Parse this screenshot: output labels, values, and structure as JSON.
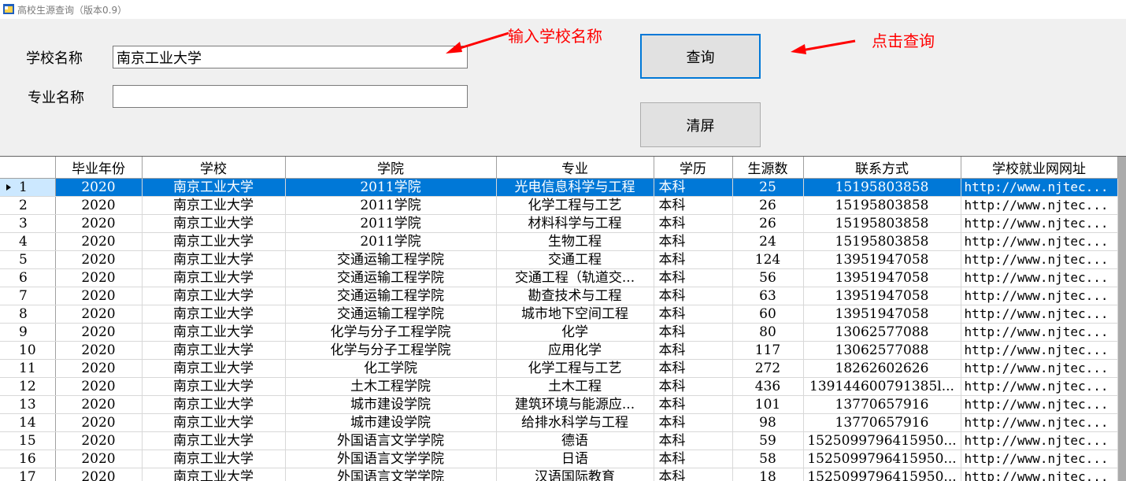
{
  "window": {
    "title": "高校生源查询（版本0.9）",
    "icon": "app-window-icon"
  },
  "form": {
    "school_label": "学校名称",
    "school_value": "南京工业大学",
    "major_label": "专业名称",
    "major_value": ""
  },
  "buttons": {
    "query": "查询",
    "clear": "清屏"
  },
  "annotations": {
    "input_hint": "输入学校名称",
    "click_hint": "点击查询",
    "color": "#ff0000"
  },
  "grid": {
    "columns": [
      "",
      "毕业年份",
      "学校",
      "学院",
      "专业",
      "学历",
      "生源数",
      "联系方式",
      "学校就业网网址"
    ],
    "selected_row": 0,
    "selection_color": "#0078d7",
    "rows": [
      [
        "1",
        "2020",
        "南京工业大学",
        "2011学院",
        "光电信息科学与工程",
        "本科",
        "25",
        "15195803858",
        "http://www.njtec..."
      ],
      [
        "2",
        "2020",
        "南京工业大学",
        "2011学院",
        "化学工程与工艺",
        "本科",
        "26",
        "15195803858",
        "http://www.njtec..."
      ],
      [
        "3",
        "2020",
        "南京工业大学",
        "2011学院",
        "材料科学与工程",
        "本科",
        "26",
        "15195803858",
        "http://www.njtec..."
      ],
      [
        "4",
        "2020",
        "南京工业大学",
        "2011学院",
        "生物工程",
        "本科",
        "24",
        "15195803858",
        "http://www.njtec..."
      ],
      [
        "5",
        "2020",
        "南京工业大学",
        "交通运输工程学院",
        "交通工程",
        "本科",
        "124",
        "13951947058",
        "http://www.njtec..."
      ],
      [
        "6",
        "2020",
        "南京工业大学",
        "交通运输工程学院",
        "交通工程（轨道交...",
        "本科",
        "56",
        "13951947058",
        "http://www.njtec..."
      ],
      [
        "7",
        "2020",
        "南京工业大学",
        "交通运输工程学院",
        "勘查技术与工程",
        "本科",
        "63",
        "13951947058",
        "http://www.njtec..."
      ],
      [
        "8",
        "2020",
        "南京工业大学",
        "交通运输工程学院",
        "城市地下空间工程",
        "本科",
        "60",
        "13951947058",
        "http://www.njtec..."
      ],
      [
        "9",
        "2020",
        "南京工业大学",
        "化学与分子工程学院",
        "化学",
        "本科",
        "80",
        "13062577088",
        "http://www.njtec..."
      ],
      [
        "10",
        "2020",
        "南京工业大学",
        "化学与分子工程学院",
        "应用化学",
        "本科",
        "117",
        "13062577088",
        "http://www.njtec..."
      ],
      [
        "11",
        "2020",
        "南京工业大学",
        "化工学院",
        "化学工程与工艺",
        "本科",
        "272",
        "18262602626",
        "http://www.njtec..."
      ],
      [
        "12",
        "2020",
        "南京工业大学",
        "土木工程学院",
        "土木工程",
        "本科",
        "436",
        "139144600791385l...",
        "http://www.njtec..."
      ],
      [
        "13",
        "2020",
        "南京工业大学",
        "城市建设学院",
        "建筑环境与能源应...",
        "本科",
        "101",
        "13770657916",
        "http://www.njtec..."
      ],
      [
        "14",
        "2020",
        "南京工业大学",
        "城市建设学院",
        "给排水科学与工程",
        "本科",
        "98",
        "13770657916",
        "http://www.njtec..."
      ],
      [
        "15",
        "2020",
        "南京工业大学",
        "外国语言文学学院",
        "德语",
        "本科",
        "59",
        "1525099796415950...",
        "http://www.njtec..."
      ],
      [
        "16",
        "2020",
        "南京工业大学",
        "外国语言文学学院",
        "日语",
        "本科",
        "58",
        "1525099796415950...",
        "http://www.njtec..."
      ],
      [
        "17",
        "2020",
        "南京工业大学",
        "外国语言文学学院",
        "汉语国际教育",
        "本科",
        "18",
        "1525099796415950...",
        "http://www.njtec..."
      ]
    ]
  }
}
